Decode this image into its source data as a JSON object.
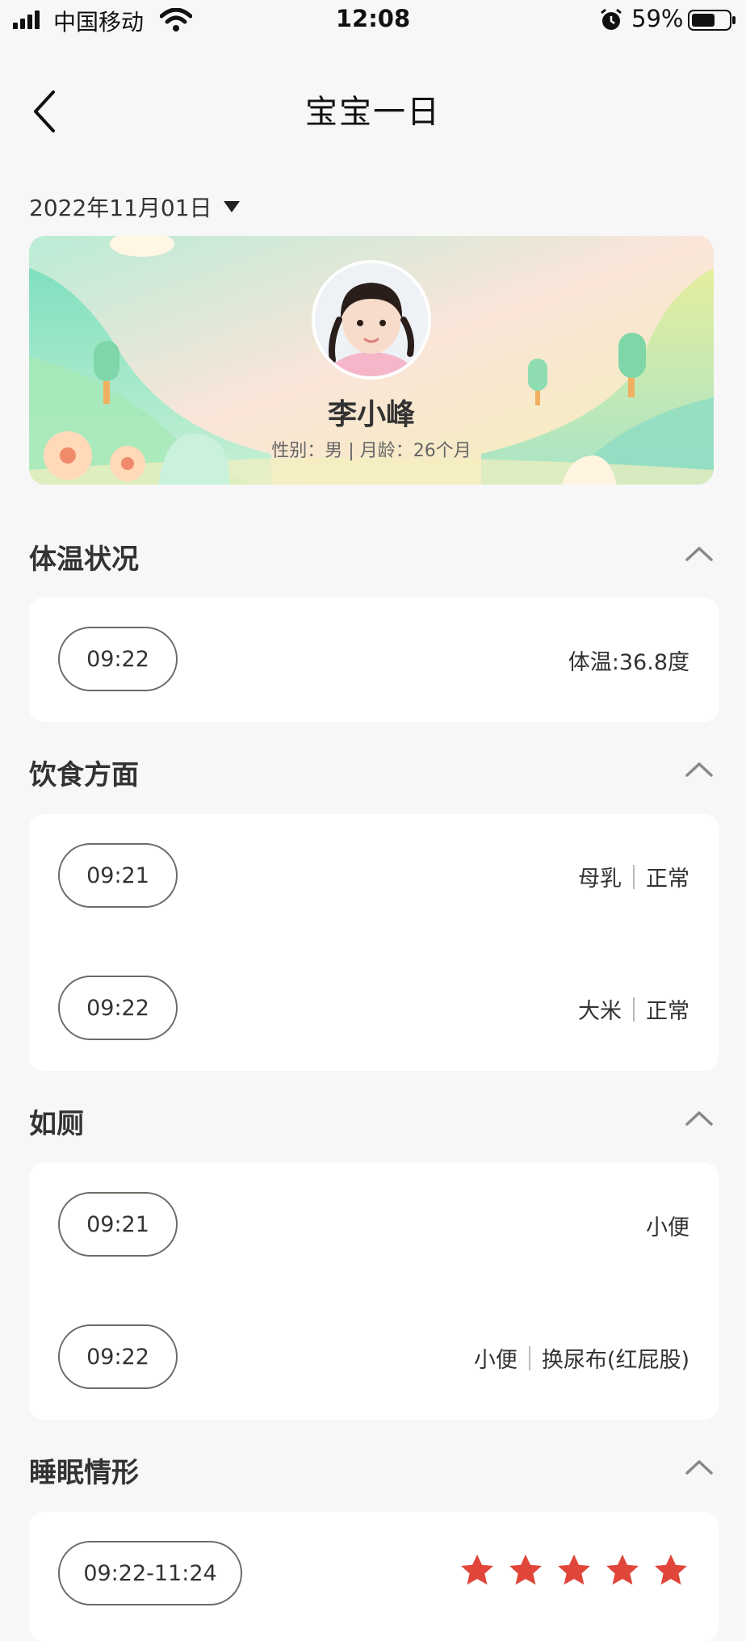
{
  "status_bar": {
    "carrier": "中国移动",
    "time": "12:08",
    "battery_percent": "59%",
    "icons": [
      "signal-icon",
      "wifi-icon",
      "alarm-icon",
      "battery-icon"
    ]
  },
  "nav": {
    "title": "宝宝一日",
    "back_icon": "back-icon"
  },
  "date_selector": {
    "value": "2022年11月01日",
    "icon": "caret-down-icon"
  },
  "profile": {
    "name": "李小峰",
    "info": "性别：男 | 月龄：26个月"
  },
  "sections": {
    "temperature": {
      "title": "体温状况",
      "rows": [
        {
          "time": "09:22",
          "value": "体温:36.8度"
        }
      ]
    },
    "diet": {
      "title": "饮食方面",
      "rows": [
        {
          "time": "09:21",
          "item": "母乳",
          "status": "正常"
        },
        {
          "time": "09:22",
          "item": "大米",
          "status": "正常"
        }
      ]
    },
    "toilet": {
      "title": "如厕",
      "rows": [
        {
          "time": "09:21",
          "item": "小便"
        },
        {
          "time": "09:22",
          "item": "小便",
          "status": "换尿布(红屁股)"
        }
      ]
    },
    "sleep": {
      "title": "睡眠情形",
      "rows": [
        {
          "time": "09:22-11:24",
          "rating": 5,
          "rating_max": 5
        }
      ]
    }
  },
  "colors": {
    "background": "#f7f7f7",
    "card": "#ffffff",
    "star": "#e0463a",
    "pill_border": "#6e6a64"
  }
}
